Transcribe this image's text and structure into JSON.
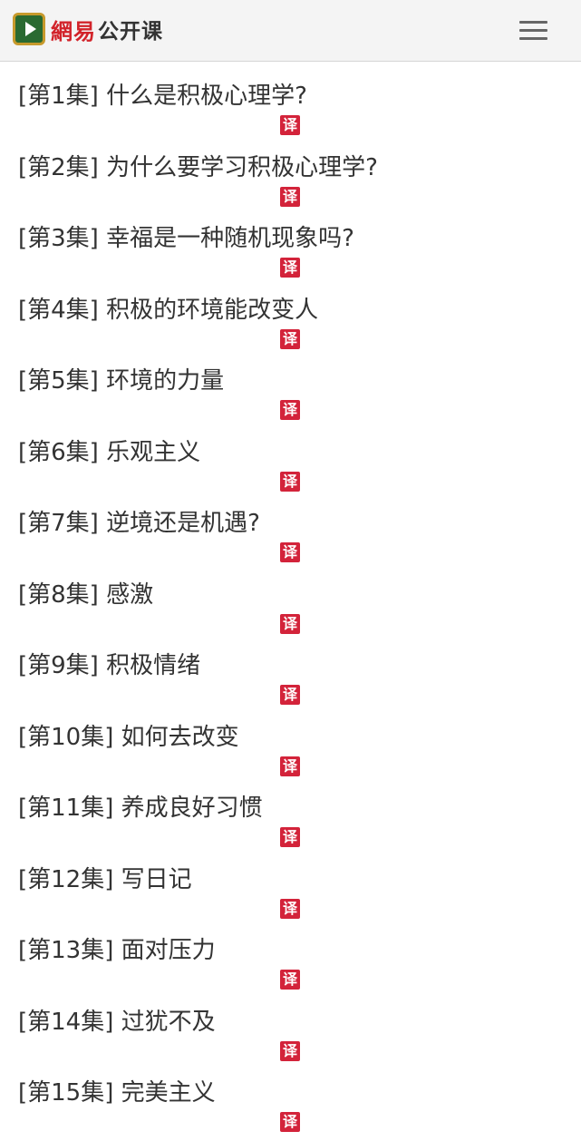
{
  "header": {
    "logo_icon": "play-board-icon",
    "brand": "網易",
    "name": "公开课",
    "menu_icon": "hamburger-menu-icon",
    "colors": {
      "brand_red": "#d2232a",
      "icon_green": "#2a6a31",
      "icon_gold": "#c79a2c"
    }
  },
  "badge": {
    "label": "译",
    "color": "#d3233a"
  },
  "episodes": [
    {
      "title": "[第1集] 什么是积极心理学?"
    },
    {
      "title": "[第2集] 为什么要学习积极心理学?"
    },
    {
      "title": "[第3集] 幸福是一种随机现象吗?"
    },
    {
      "title": "[第4集] 积极的环境能改变人"
    },
    {
      "title": "[第5集] 环境的力量"
    },
    {
      "title": "[第6集] 乐观主义"
    },
    {
      "title": "[第7集] 逆境还是机遇?"
    },
    {
      "title": "[第8集] 感激"
    },
    {
      "title": "[第9集] 积极情绪"
    },
    {
      "title": "[第10集] 如何去改变"
    },
    {
      "title": "[第11集] 养成良好习惯"
    },
    {
      "title": "[第12集] 写日记"
    },
    {
      "title": "[第13集] 面对压力"
    },
    {
      "title": "[第14集] 过犹不及"
    },
    {
      "title": "[第15集] 完美主义"
    }
  ]
}
